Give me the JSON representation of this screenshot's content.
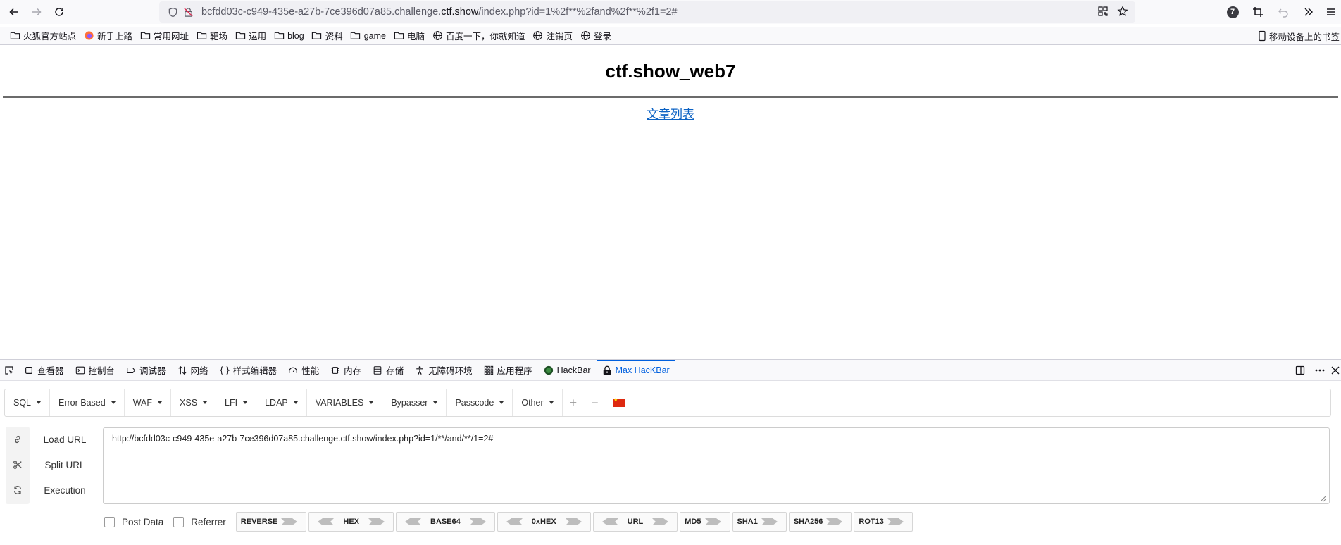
{
  "browser": {
    "url_prefix": "bcfdd03c-c949-435e-a27b-7ce396d07a85.challenge.",
    "url_host": "ctf.show",
    "url_suffix": "/index.php?id=1%2f**%2fand%2f**%2f1=2#",
    "extension_badge": "7"
  },
  "bookmarks": {
    "items": [
      {
        "label": "火狐官方站点",
        "icon": "folder-icon"
      },
      {
        "label": "新手上路",
        "icon": "firefox-icon"
      },
      {
        "label": "常用网址",
        "icon": "folder-icon"
      },
      {
        "label": "靶场",
        "icon": "folder-icon"
      },
      {
        "label": "运用",
        "icon": "folder-icon"
      },
      {
        "label": "blog",
        "icon": "folder-icon"
      },
      {
        "label": "资料",
        "icon": "folder-icon"
      },
      {
        "label": "game",
        "icon": "folder-icon"
      },
      {
        "label": "电脑",
        "icon": "folder-icon"
      },
      {
        "label": "百度一下，你就知道",
        "icon": "globe-icon"
      },
      {
        "label": "注销页",
        "icon": "globe-icon"
      },
      {
        "label": "登录",
        "icon": "globe-icon"
      }
    ],
    "mobile": "移动设备上的书签"
  },
  "page": {
    "title": "ctf.show_web7",
    "link": "文章列表"
  },
  "devtools": {
    "tabs": [
      {
        "label": "查看器",
        "icon": "inspector-icon"
      },
      {
        "label": "控制台",
        "icon": "console-icon"
      },
      {
        "label": "调试器",
        "icon": "debugger-icon"
      },
      {
        "label": "网络",
        "icon": "network-icon"
      },
      {
        "label": "样式编辑器",
        "icon": "style-editor-icon"
      },
      {
        "label": "性能",
        "icon": "performance-icon"
      },
      {
        "label": "内存",
        "icon": "memory-icon"
      },
      {
        "label": "存储",
        "icon": "storage-icon"
      },
      {
        "label": "无障碍环境",
        "icon": "accessibility-icon"
      },
      {
        "label": "应用程序",
        "icon": "application-icon"
      },
      {
        "label": "HackBar",
        "icon": "hackbar-icon"
      },
      {
        "label": "Max HacKBar",
        "icon": "max-hackbar-icon"
      }
    ]
  },
  "hackbar": {
    "menus": [
      "SQL",
      "Error Based",
      "WAF",
      "XSS",
      "LFI",
      "LDAP",
      "VARIABLES",
      "Bypasser",
      "Passcode",
      "Other"
    ],
    "actions": {
      "load": "Load URL",
      "split": "Split URL",
      "execute": "Execution"
    },
    "url_value": "http://bcfdd03c-c949-435e-a27b-7ce396d07a85.challenge.ctf.show/index.php?id=1/**/and/**/1=2#",
    "post_data": "Post Data",
    "referrer": "Referrer",
    "encoders": [
      "REVERSE",
      "HEX",
      "BASE64",
      "0xHEX",
      "URL",
      "MD5",
      "SHA1",
      "SHA256",
      "ROT13"
    ],
    "encoders_with_left_arrow": [
      "HEX",
      "BASE64",
      "0xHEX",
      "URL"
    ]
  }
}
